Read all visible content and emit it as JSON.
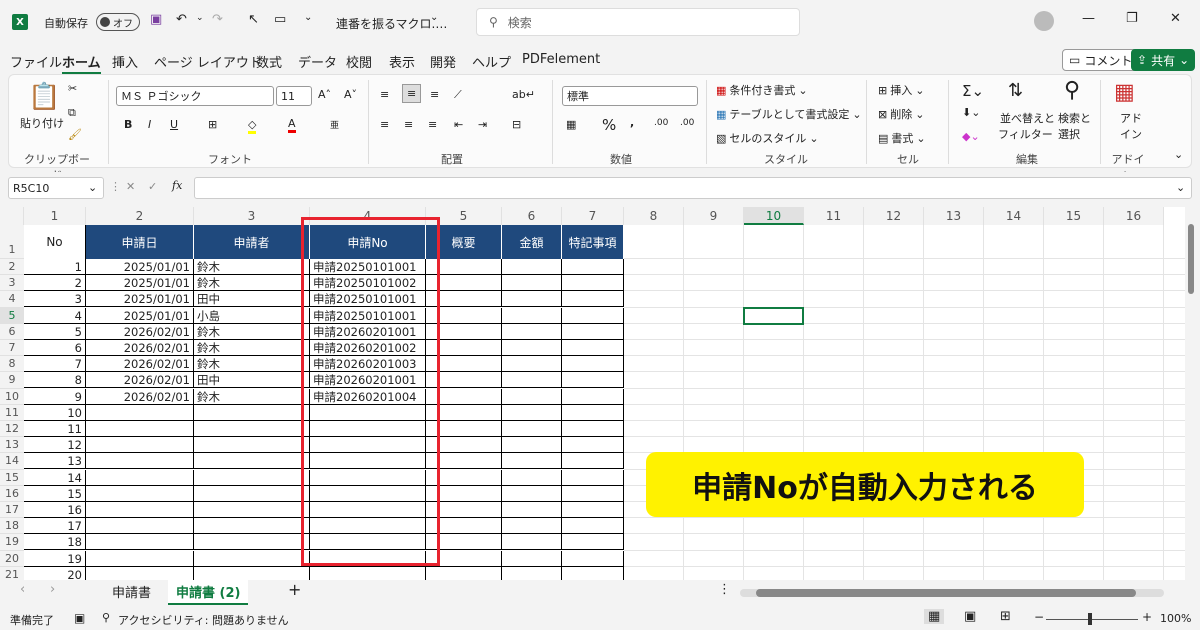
{
  "titlebar": {
    "autosave_label": "自動保存",
    "autosave_state": "オフ",
    "filename": "連番を振るマクロ.…",
    "search_placeholder": "検索"
  },
  "menubar": {
    "items": [
      "ファイル",
      "ホーム",
      "挿入",
      "ページ レイアウト",
      "数式",
      "データ",
      "校閲",
      "表示",
      "開発",
      "ヘルプ",
      "PDFelement"
    ],
    "active": "ホーム",
    "comment_button": "コメント",
    "share_button": "共有"
  },
  "ribbon": {
    "clipboard": {
      "paste": "貼り付け",
      "group": "クリップボード"
    },
    "font": {
      "name": "ＭＳ Ｐゴシック",
      "size": "11",
      "group": "フォント"
    },
    "alignment": {
      "group": "配置"
    },
    "number": {
      "format": "標準",
      "group": "数値"
    },
    "styles": {
      "conditional": "条件付き書式",
      "table": "テーブルとして書式設定",
      "cell": "セルのスタイル",
      "group": "スタイル"
    },
    "cells": {
      "insert": "挿入",
      "delete": "削除",
      "format": "書式",
      "group": "セル"
    },
    "editing": {
      "sort": "並べ替えと",
      "sort2": "フィルター",
      "find": "検索と",
      "find2": "選択",
      "group": "編集"
    },
    "addin": {
      "label1": "アド",
      "label2": "イン",
      "group": "アドイン"
    }
  },
  "formula_bar": {
    "name_box": "R5C10",
    "fx": "fx",
    "value": ""
  },
  "columns": [
    "1",
    "2",
    "3",
    "4",
    "5",
    "6",
    "7",
    "8",
    "9",
    "10",
    "11",
    "12",
    "13",
    "14",
    "15",
    "16"
  ],
  "rows": [
    "1",
    "2",
    "3",
    "4",
    "5",
    "6",
    "7",
    "8",
    "9",
    "10",
    "11",
    "12",
    "13",
    "14",
    "15",
    "16",
    "17",
    "18",
    "19",
    "20",
    "21"
  ],
  "table": {
    "headers": [
      "No",
      "申請日",
      "申請者",
      "申請No",
      "概要",
      "金額",
      "特記事項"
    ],
    "records": [
      [
        "1",
        "2025/01/01",
        "鈴木",
        "申請20250101001"
      ],
      [
        "2",
        "2025/01/01",
        "鈴木",
        "申請20250101002"
      ],
      [
        "3",
        "2025/01/01",
        "田中",
        "申請20250101001"
      ],
      [
        "4",
        "2025/01/01",
        "小島",
        "申請20250101001"
      ],
      [
        "5",
        "2026/02/01",
        "鈴木",
        "申請20260201001"
      ],
      [
        "6",
        "2026/02/01",
        "鈴木",
        "申請20260201002"
      ],
      [
        "7",
        "2026/02/01",
        "鈴木",
        "申請20260201003"
      ],
      [
        "8",
        "2026/02/01",
        "田中",
        "申請20260201001"
      ],
      [
        "9",
        "2026/02/01",
        "鈴木",
        "申請20260201004"
      ],
      [
        "10"
      ],
      [
        "11"
      ],
      [
        "12"
      ],
      [
        "13"
      ],
      [
        "14"
      ],
      [
        "15"
      ],
      [
        "16"
      ],
      [
        "17"
      ],
      [
        "18"
      ],
      [
        "19"
      ],
      [
        "20"
      ]
    ]
  },
  "callout": "申請Noが自動入力される",
  "sheets": {
    "tabs": [
      "申請書",
      "申請書 (2)"
    ],
    "active": "申請書 (2)"
  },
  "status": {
    "ready": "準備完了",
    "accessibility": "アクセシビリティ: 問題ありません",
    "zoom": "100%"
  },
  "colors": {
    "excel_green": "#107c41",
    "header_blue": "#1f497d",
    "callout_yellow": "#fff200",
    "highlight_red": "#e8232f"
  }
}
